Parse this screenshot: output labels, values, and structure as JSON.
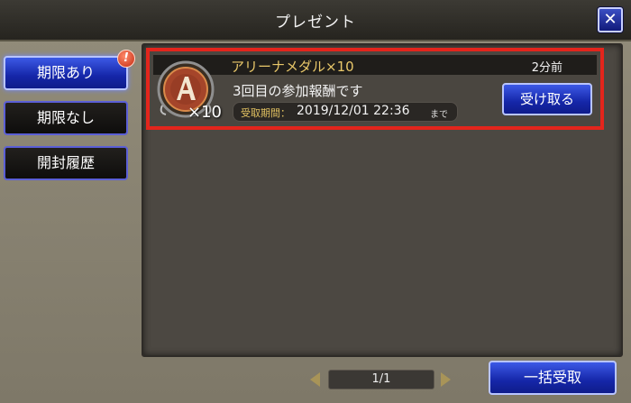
{
  "window": {
    "title": "プレゼント",
    "close_label": "✕"
  },
  "sidebar": {
    "items": [
      {
        "label": "期限あり",
        "active": true,
        "badge": "!"
      },
      {
        "label": "期限なし",
        "active": false
      },
      {
        "label": "開封履歴",
        "active": false
      }
    ]
  },
  "gifts": [
    {
      "name": "アリーナメダル×10",
      "time": "2分前",
      "quantity": "×10",
      "description": "3回目の参加報酬です",
      "period_label": "受取期間：",
      "period_date": "2019/12/01 22:36",
      "period_suffix": "まで",
      "receive_label": "受け取る",
      "icon": "arena-medal-icon"
    }
  ],
  "pager": {
    "text": "1/1"
  },
  "footer": {
    "bulk_receive_label": "一括受取"
  },
  "colors": {
    "accent_blue": "#1526a8",
    "highlight_red": "#e3251c",
    "gold_text": "#e9c86a"
  }
}
